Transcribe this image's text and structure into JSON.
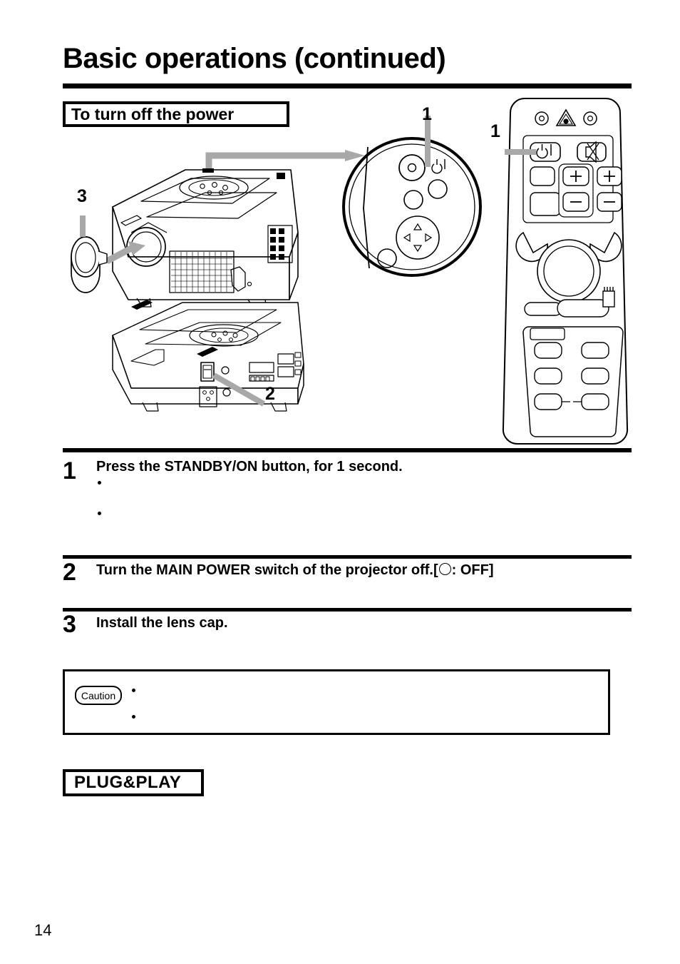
{
  "page": {
    "title": "Basic operations (continued)",
    "number": "14"
  },
  "section": {
    "heading": "To turn off the power"
  },
  "illustration": {
    "callouts": [
      {
        "id": "1a",
        "label": "1",
        "target": "projector-control-panel-standby-on-button"
      },
      {
        "id": "1b",
        "label": "1",
        "target": "remote-standby-on-button"
      },
      {
        "id": "2",
        "label": "2",
        "target": "projector-main-power-switch"
      },
      {
        "id": "3",
        "label": "3",
        "target": "lens-cap"
      }
    ],
    "items": {
      "projector_front": "projector front three-quarter view",
      "projector_rear": "projector rear three-quarter view",
      "lens_cap": "lens cap",
      "control_panel_detail": "magnified control panel circle",
      "remote": "remote control"
    }
  },
  "steps": [
    {
      "number": "1",
      "text": "Press the STANDBY/ON button, for 1 second.",
      "bullets": [
        "",
        ""
      ]
    },
    {
      "number": "2",
      "text_before": "Turn the MAIN POWER switch of the projector off.[",
      "text_after": ": OFF]",
      "bullets": []
    },
    {
      "number": "3",
      "text": "Install the lens cap.",
      "bullets": []
    }
  ],
  "caution": {
    "label": "Caution",
    "bullets": [
      "",
      ""
    ]
  },
  "plug_and_play": {
    "heading": "PLUG&PLAY"
  },
  "colors": {
    "ink": "#000000",
    "paper": "#ffffff",
    "callout_leader": "#a8a8a8"
  }
}
